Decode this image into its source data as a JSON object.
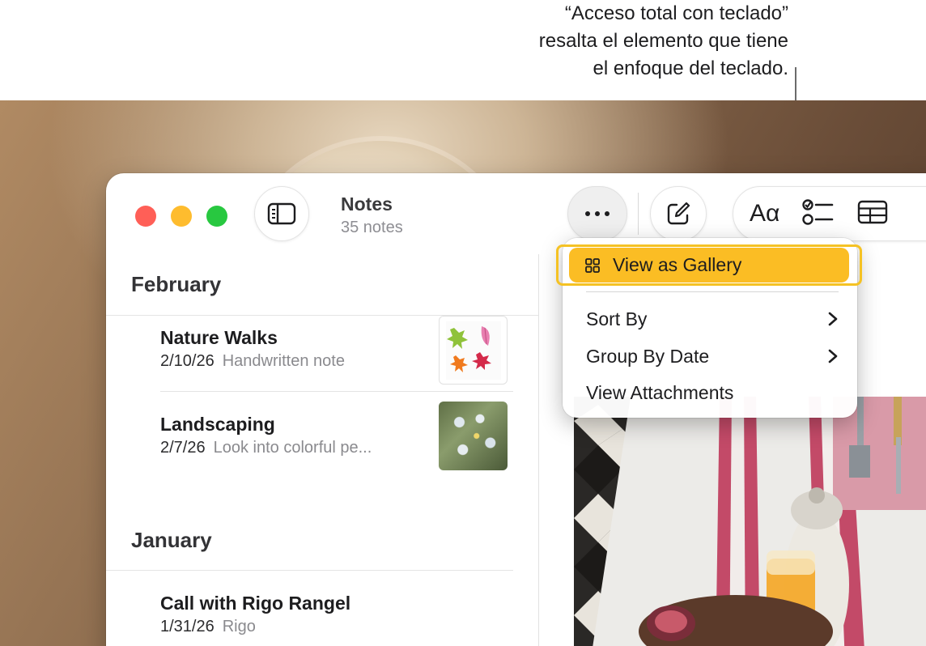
{
  "callout": {
    "line1": "“Acceso total con teclado”",
    "line2": "resalta el elemento que tiene",
    "line3": "el enfoque del teclado."
  },
  "toolbar": {
    "title": "Notes",
    "subtitle": "35 notes",
    "format_label": "Aα"
  },
  "sections": [
    {
      "header": "February",
      "notes": [
        {
          "title": "Nature Walks",
          "date": "2/10/26",
          "preview": "Handwritten note"
        },
        {
          "title": "Landscaping",
          "date": "2/7/26",
          "preview": "Look into colorful pe..."
        }
      ]
    },
    {
      "header": "January",
      "notes": [
        {
          "title": "Call with Rigo Rangel",
          "date": "1/31/26",
          "preview": "Rigo"
        }
      ]
    }
  ],
  "menu": {
    "items": [
      {
        "label": "View as Gallery",
        "icon": "grid-icon",
        "focused": true
      },
      {
        "label": "Sort By",
        "submenu": true
      },
      {
        "label": "Group By Date",
        "submenu": true
      },
      {
        "label": "View Attachments",
        "submenu": false
      }
    ]
  },
  "colors": {
    "focus_highlight": "#fbbd24",
    "focus_ring": "#f5c224",
    "close": "#ff5f57",
    "minimize": "#febc2e",
    "maximize": "#28c840"
  }
}
